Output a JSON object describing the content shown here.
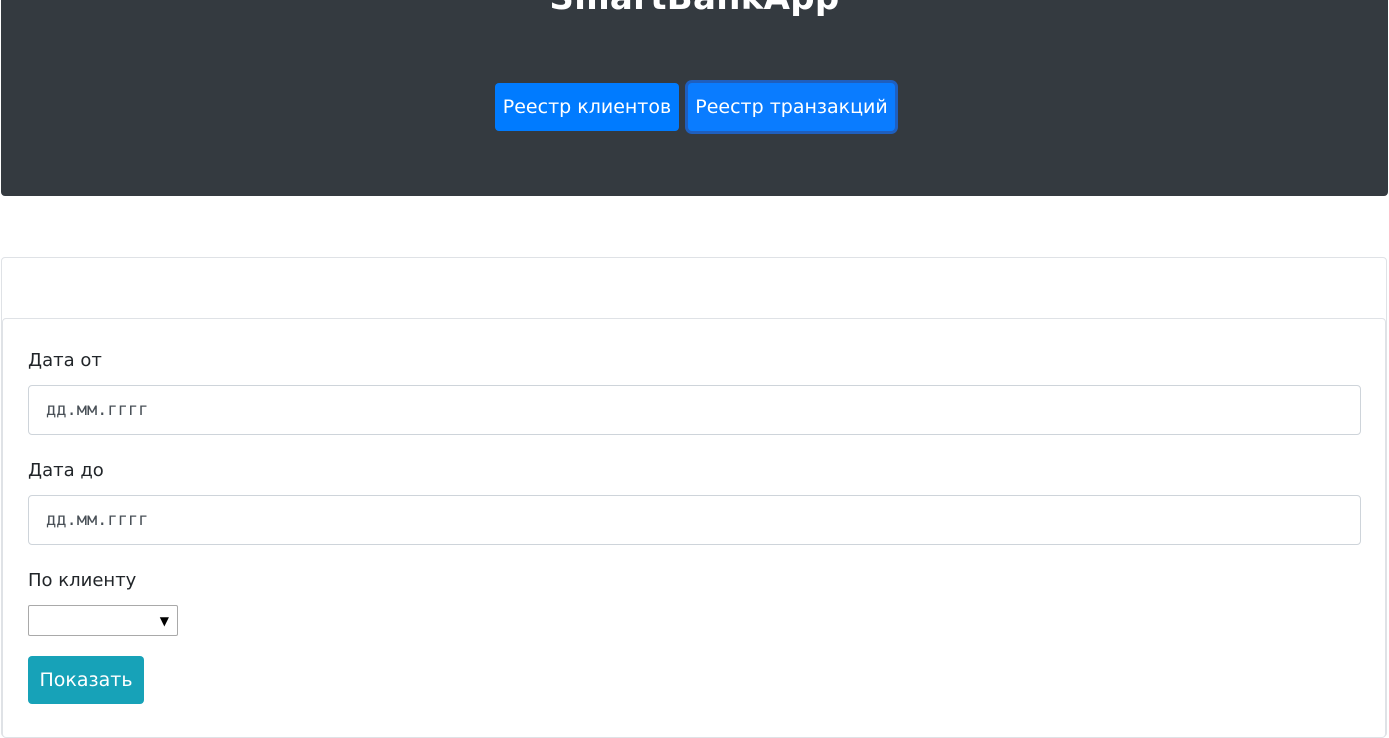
{
  "header": {
    "title": "SmartBankApp",
    "nav": [
      {
        "label": "Реестр клиентов"
      },
      {
        "label": "Реестр транзакций"
      }
    ]
  },
  "filter_form": {
    "date_from": {
      "label": "Дата от",
      "placeholder": "дд.мм.гггг"
    },
    "date_to": {
      "label": "Дата до",
      "placeholder": "дд.мм.гггг"
    },
    "client": {
      "label": "По клиенту",
      "selected": ""
    },
    "submit_label": "Показать"
  },
  "colors": {
    "header_bg": "#343a40",
    "primary": "#007bff",
    "info": "#17a2b8"
  }
}
